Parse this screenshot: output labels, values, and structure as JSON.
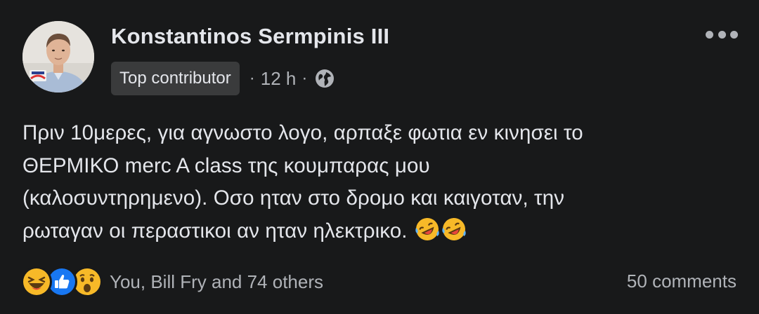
{
  "post": {
    "author": "Konstantinos Sermpinis III",
    "badge": "Top contributor",
    "separator": "·",
    "time": "12 h",
    "audience_icon": "globe-icon",
    "lines": [
      "Πριν 10μερες, για αγνωστο λογο, αρπαξε φωτια εν κινησει το",
      "ΘΕΡΜΙΚΟ merc A class της κουμπαρας μου",
      "(καλοσυντηρημενο). Οσο ηταν στο δρομο και καιγοταν, την",
      "ρωταγαν οι περαστικοι αν ηταν ηλεκτρικο."
    ],
    "trailing_emoji": [
      "rolling-laughing-emoji",
      "rolling-laughing-emoji"
    ]
  },
  "footer": {
    "reaction_icons": [
      "haha-reaction-icon",
      "like-reaction-icon",
      "wow-reaction-icon"
    ],
    "reaction_names": "You, Bill Fry and 74 others",
    "comments": "50 comments"
  },
  "colors": {
    "background": "#18191a",
    "text_primary": "#e4e6eb",
    "text_secondary": "#b0b3b8",
    "badge_bg": "#3a3b3c",
    "like_blue": "#1877f2",
    "emoji_yellow": "#f7b928"
  }
}
